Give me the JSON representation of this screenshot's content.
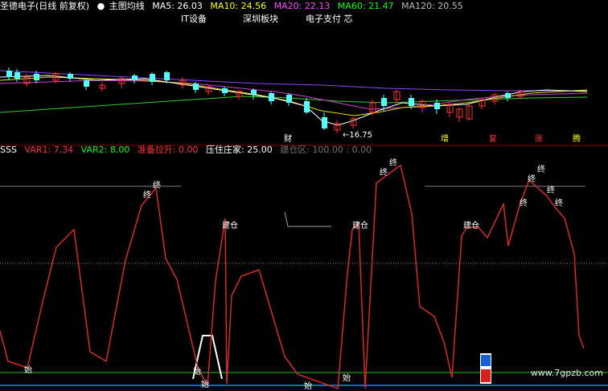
{
  "header": {
    "title": "圣德电子(日线 前复权)",
    "indicator_name": "主图均线",
    "ma": [
      {
        "label": "MA5: 26.03",
        "color": "#ffffff"
      },
      {
        "label": "MA10: 24.56",
        "color": "#ffff00"
      },
      {
        "label": "MA20: 22.13",
        "color": "#ff44ff"
      },
      {
        "label": "MA60: 21.47",
        "color": "#00ff00"
      },
      {
        "label": "MA120: 20.55",
        "color": "#bbbbbb"
      }
    ]
  },
  "sectors": [
    "IT设备",
    "深圳板块",
    "电子支付 芯"
  ],
  "price_chart": {
    "low_marker": "←16.75",
    "event_tags": [
      "财",
      "增",
      "复",
      "涨",
      "腾"
    ]
  },
  "sub_header": {
    "name": "SSS",
    "items": [
      {
        "label": "VAR1: 7.34",
        "color": "#ff3030"
      },
      {
        "label": "VAR2: 8.00",
        "color": "#00ff00"
      },
      {
        "label": "准备拉升: 0.00",
        "color": "#ff3030"
      },
      {
        "label": "压住庄家: 25.00",
        "color": "#ffffff"
      },
      {
        "label": "建仓区: 100.00 : 0.00",
        "color": "#707070"
      }
    ]
  },
  "indicator_chart": {
    "labels": {
      "zhong": "终",
      "jiancang": "建仓",
      "shi": "始"
    }
  },
  "watermark": "www.7gpzb.com",
  "colors": {
    "background": "#000000",
    "up_candle": "#ff3030",
    "down_candle": "#54ffff",
    "signal_line": "#d42a2a"
  }
}
